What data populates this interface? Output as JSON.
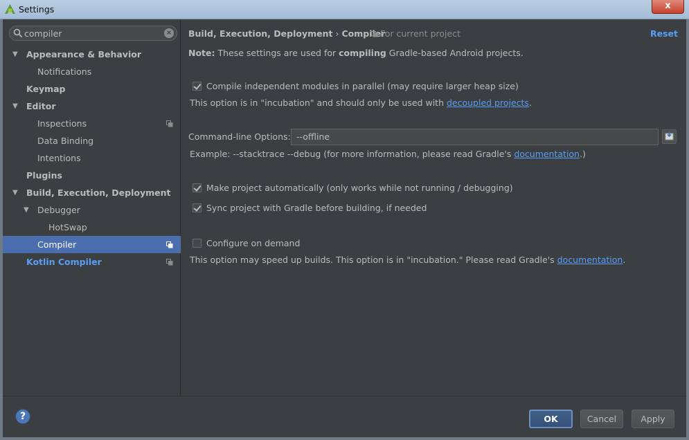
{
  "window": {
    "title": "Settings",
    "close_label": "x"
  },
  "search": {
    "value": "compiler"
  },
  "tree": [
    {
      "label": "Appearance & Behavior",
      "bold": true,
      "expanded": true
    },
    {
      "label": "Notifications"
    },
    {
      "label": "Keymap",
      "bold": true
    },
    {
      "label": "Editor",
      "bold": true,
      "expanded": true
    },
    {
      "label": "Inspections",
      "project_scope": true
    },
    {
      "label": "Data Binding"
    },
    {
      "label": "Intentions"
    },
    {
      "label": "Plugins",
      "bold": true
    },
    {
      "label": "Build, Execution, Deployment",
      "bold": true,
      "expanded": true
    },
    {
      "label": "Debugger",
      "expanded": true
    },
    {
      "label": "HotSwap"
    },
    {
      "label": "Compiler",
      "selected": true,
      "project_scope": true
    },
    {
      "label": "Kotlin Compiler",
      "project_scope": true
    }
  ],
  "content": {
    "breadcrumb": [
      "Build, Execution, Deployment",
      "Compiler"
    ],
    "breadcrumb_sep": "›",
    "scope_label": "For current project",
    "reset_label": "Reset",
    "note": {
      "prefix": "Note:",
      "text1": " These settings are used for ",
      "emph": "compiling",
      "text2": " Gradle-based Android projects."
    },
    "parallel": {
      "checked": true,
      "label": "Compile independent modules in parallel (may require larger heap size)",
      "help_prefix": "This option is in \"incubation\" and should only be used with ",
      "help_link": "decoupled projects",
      "help_suffix": "."
    },
    "command_line": {
      "label": "Command-line Options:",
      "value": "--offline",
      "example_prefix": "Example: --stacktrace --debug (for more information, please read Gradle's ",
      "example_link": "documentation",
      "example_suffix": ".)"
    },
    "make_auto": {
      "checked": true,
      "label": "Make project automatically (only works while not running / debugging)"
    },
    "sync_gradle": {
      "checked": true,
      "label": "Sync project with Gradle before building, if needed"
    },
    "configure_demand": {
      "checked": false,
      "label": "Configure on demand",
      "help_prefix": "This option may speed up builds. This option is in \"incubation.\" Please read Gradle's ",
      "help_link": "documentation",
      "help_suffix": "."
    }
  },
  "buttons": {
    "help": "?",
    "ok": "OK",
    "cancel": "Cancel",
    "apply": "Apply"
  },
  "colors": {
    "background": "#3c3f41",
    "selection": "#4b6eaf",
    "link": "#589df6",
    "text": "#bbbbbb"
  }
}
